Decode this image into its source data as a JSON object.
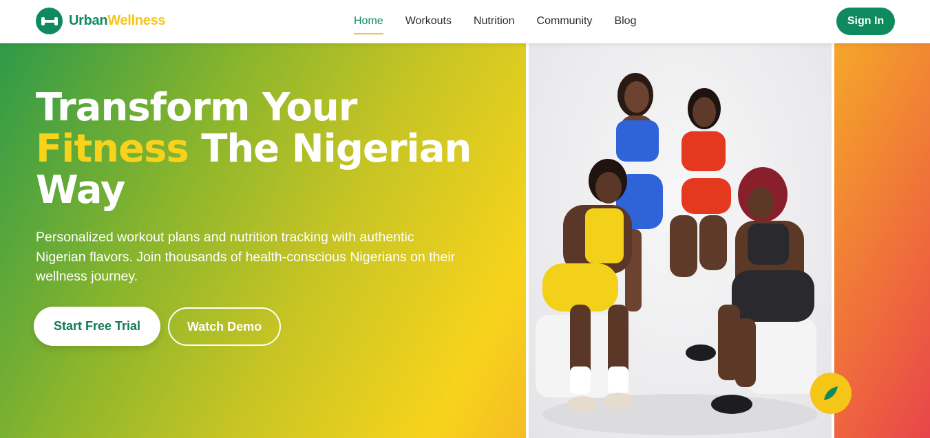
{
  "brand": {
    "name_part1": "Urban",
    "name_part2": "Wellness"
  },
  "nav": {
    "items": [
      {
        "label": "Home",
        "active": true
      },
      {
        "label": "Workouts",
        "active": false
      },
      {
        "label": "Nutrition",
        "active": false
      },
      {
        "label": "Community",
        "active": false
      },
      {
        "label": "Blog",
        "active": false
      }
    ]
  },
  "header": {
    "signin_label": "Sign In"
  },
  "hero": {
    "title_line1": "Transform Your",
    "title_highlight": "Fitness",
    "title_line2_rest": " The Nigerian",
    "title_line3": "Way",
    "subtitle": "Personalized workout plans and nutrition tracking with authentic Nigerian flavors. Join thousands of health-conscious Nigerians on their wellness journey.",
    "primary_cta": "Start Free Trial",
    "secondary_cta": "Watch Demo",
    "image_description_icon": "group-photo"
  },
  "colors": {
    "brand_green": "#0f8a5f",
    "brand_yellow": "#f5c518",
    "gradient_start": "#2e9a48",
    "gradient_end": "#e8454a"
  },
  "icons": {
    "logo": "dumbbell-icon",
    "badge": "leaf-icon"
  }
}
